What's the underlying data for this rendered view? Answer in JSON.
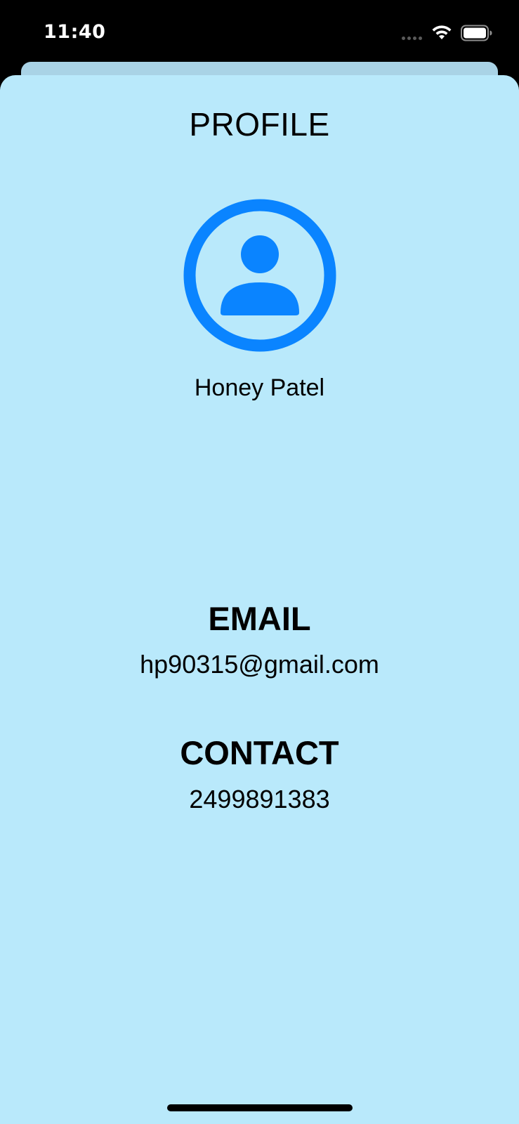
{
  "status_bar": {
    "time": "11:40",
    "icons": [
      "cellular-signal-icon",
      "wifi-icon",
      "battery-icon"
    ]
  },
  "profile": {
    "title": "PROFILE",
    "avatar_icon": "person-circle-icon",
    "name": "Honey Patel"
  },
  "email": {
    "label": "EMAIL",
    "value": "hp90315@gmail.com"
  },
  "contact": {
    "label": "CONTACT",
    "value": "2499891383"
  },
  "colors": {
    "background": "#b9e9fb",
    "accent": "#0a84ff",
    "status_bar": "#000000"
  }
}
